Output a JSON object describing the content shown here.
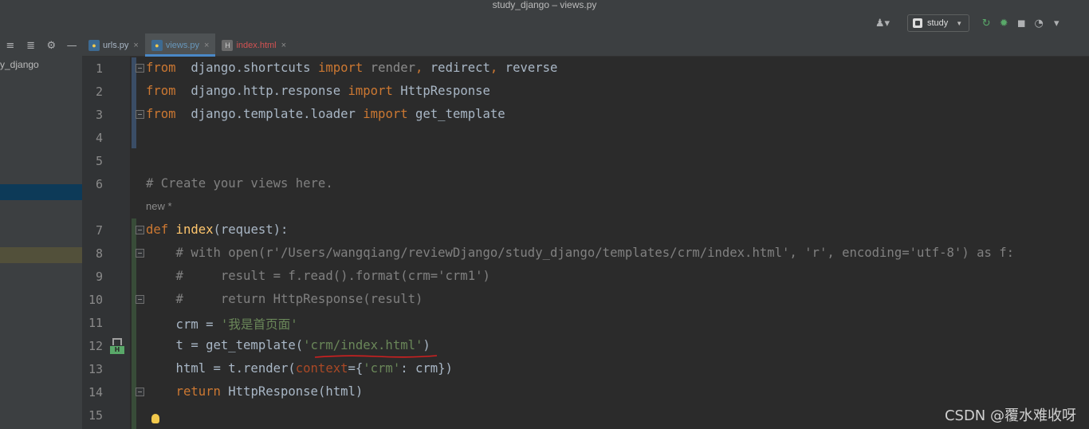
{
  "window": {
    "title": "study_django – views.py"
  },
  "toolbar": {
    "run_config": "study",
    "icons": [
      "user-icon",
      "config-icon",
      "rerun-icon",
      "debug-icon",
      "coverage-icon",
      "profile-icon",
      "more-icon"
    ]
  },
  "project": {
    "label": "y_django"
  },
  "tabs": [
    {
      "label": "urls.py",
      "type": "python",
      "color": "#a9b7c6"
    },
    {
      "label": "views.py",
      "type": "python",
      "color": "#6897bb"
    },
    {
      "label": "index.html",
      "type": "html",
      "color": "#d25252"
    }
  ],
  "editor": {
    "line_numbers": [
      "1",
      "2",
      "3",
      "4",
      "5",
      "6",
      "7",
      "8",
      "9",
      "10",
      "11",
      "12",
      "13",
      "14",
      "15"
    ],
    "new_hint": "new *",
    "lines": [
      [
        [
          "kw",
          "from"
        ],
        [
          "",
          "  django.shortcuts "
        ],
        [
          "kw",
          "import"
        ],
        [
          "dim",
          " render"
        ],
        [
          "kw",
          ","
        ],
        [
          "",
          " redirect"
        ],
        [
          "kw",
          ","
        ],
        [
          "",
          " reverse"
        ]
      ],
      [
        [
          "kw",
          "from"
        ],
        [
          "",
          "  django.http.response "
        ],
        [
          "kw",
          "import"
        ],
        [
          "",
          " HttpResponse"
        ]
      ],
      [
        [
          "kw",
          "from"
        ],
        [
          "",
          "  django.template.loader "
        ],
        [
          "kw",
          "import"
        ],
        [
          "",
          " get_template"
        ]
      ],
      [],
      [],
      [
        [
          "cm",
          "# Create your views here."
        ]
      ],
      [
        [
          "kw",
          "def"
        ],
        [
          "fn",
          " index"
        ],
        [
          "",
          "(request):"
        ]
      ],
      [
        [
          "cm",
          "    # with open(r'/Users/wangqiang/reviewDjango/study_django/templates/crm/index.html', 'r', encoding='utf-8') as f:"
        ]
      ],
      [
        [
          "cm",
          "    #     result = f.read().format(crm='crm1')"
        ]
      ],
      [
        [
          "cm",
          "    #     return HttpResponse(result)"
        ]
      ],
      [
        [
          "",
          "    crm = "
        ],
        [
          "str",
          "'我是首页面'"
        ]
      ],
      [
        [
          "",
          "    t = get_template("
        ],
        [
          "str",
          "'crm/index.html'"
        ],
        [
          "",
          ")"
        ]
      ],
      [
        [
          "",
          "    html = t.render("
        ],
        [
          "param",
          "context"
        ],
        [
          "",
          "={"
        ],
        [
          "str",
          "'crm'"
        ],
        [
          "",
          ": crm})"
        ]
      ],
      [
        [
          "kw",
          "    return"
        ],
        [
          "",
          " HttpResponse(html)"
        ]
      ],
      []
    ]
  },
  "watermark": "CSDN @覆水难收呀"
}
